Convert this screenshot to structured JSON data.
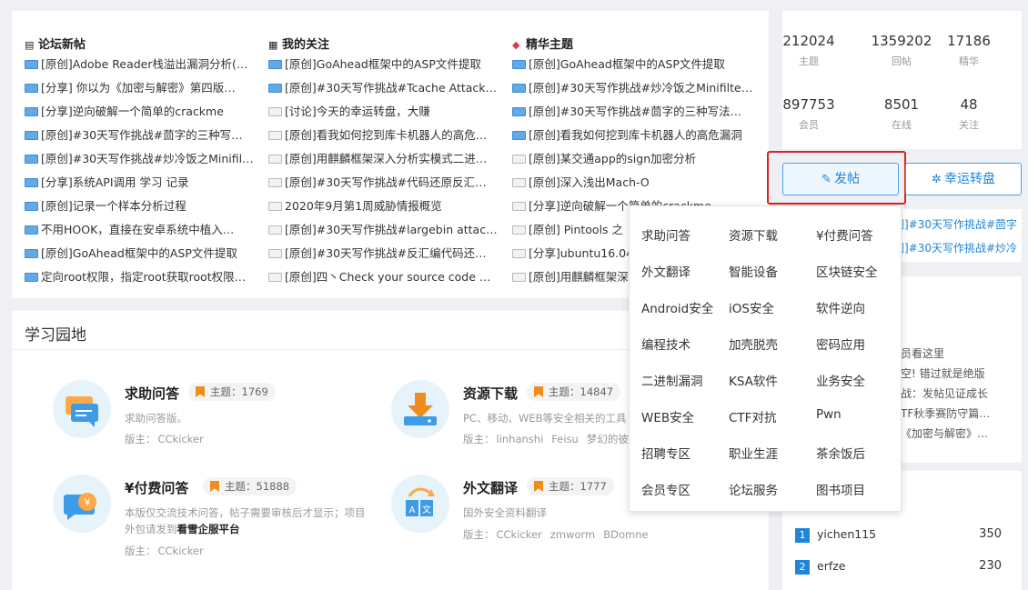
{
  "new_posts": {
    "title": "论坛新帖",
    "items": [
      "[原创]Adobe Reader栈溢出漏洞分析(…",
      "[分享] 你以为《加密与解密》第四版…",
      "[分享]逆向破解一个简单的crackme",
      "[原创]#30天写作挑战#茴字的三种写…",
      "[原创]#30天写作挑战#炒冷饭之Minifil…",
      "[分享]系统API调用 学习 记录",
      "[原创]记录一个样本分析过程",
      "不用HOOK，直接在安卓系统中植入…",
      "[原创]GoAhead框架中的ASP文件提取",
      "定向root权限，指定root获取root权限…"
    ]
  },
  "following": {
    "title": "我的关注",
    "items": [
      "[原创]GoAhead框架中的ASP文件提取",
      "[原创]#30天写作挑战#Tcache Attack…",
      "[讨论]今天的幸运转盘，大赚",
      "[原创]看我如何挖到库卡机器人的高危…",
      "[原创]用麒麟框架深入分析实模式二进…",
      "[原创]#30天写作挑战#代码还原反汇…",
      "2020年9月第1周威胁情报概览",
      "[原创]#30天写作挑战#largebin attack…",
      "[原创]#30天写作挑战#反汇编代码还…",
      "[原创]四丶Check your source code w…"
    ]
  },
  "featured": {
    "title": "精华主题",
    "items": [
      "[原创]GoAhead框架中的ASP文件提取",
      "[原创]#30天写作挑战#炒冷饭之Minifilter…",
      "[原创]#30天写作挑战#茴字的三种写法…",
      "[原创]看我如何挖到库卡机器人的高危漏洞",
      "[原创]某交通app的sign加密分析",
      "[原创]深入浅出Mach-O",
      "[分享]逆向破解一个简单的crackme",
      "[原创] Pintools 之",
      "[分享]ubuntu16.04",
      "[原创]用麒麟框架深"
    ]
  },
  "stats": [
    {
      "value": "212024",
      "label": "主题"
    },
    {
      "value": "1359202",
      "label": "回帖"
    },
    {
      "value": "17186",
      "label": "精华"
    },
    {
      "value": "897753",
      "label": "会员"
    },
    {
      "value": "8501",
      "label": "在线"
    },
    {
      "value": "48",
      "label": "关注"
    }
  ],
  "actions": {
    "post_label": "发帖",
    "lucky_label": "幸运转盘"
  },
  "side_links": [
    "创]#30天写作挑战#茴字",
    "创]#30天写作挑战#炒冷"
  ],
  "side_notice": [
    "员看这里",
    "空! 错过就是绝版",
    "战：发帖见证成长",
    "TF秋季赛防守篇…",
    "《加密与解密》…"
  ],
  "dropdown": {
    "items": [
      "求助问答",
      "资源下载",
      "¥付费问答",
      "外文翻译",
      "智能设备",
      "区块链安全",
      "Android安全",
      "iOS安全",
      "软件逆向",
      "编程技术",
      "加壳脱壳",
      "密码应用",
      "二进制漏洞",
      "KSA软件",
      "业务安全",
      "WEB安全",
      "CTF对抗",
      "Pwn",
      "招聘专区",
      "职业生涯",
      "茶余饭后",
      "会员专区",
      "论坛服务",
      "图书项目"
    ]
  },
  "learning": {
    "title": "学习园地",
    "forums": [
      {
        "title": "求助问答",
        "topics": "主题：1769",
        "desc": "求助问答版。",
        "mod_label": "版主：",
        "mods": [
          "CCkicker"
        ]
      },
      {
        "title": "资源下载",
        "topics": "主题：14847",
        "desc": "PC、移动、WEB等安全相关的工具",
        "mod_label": "版主：",
        "mods": [
          "linhanshi",
          "Feisu",
          "梦幻的彼"
        ]
      },
      {
        "title": "¥付费问答",
        "topics": "主题：51888",
        "desc": "本版仅交流技术问答，帖子需要审核后才显示；项目",
        "desc2": "外包请发到",
        "desc2_bold": "看雪企服平台",
        "mod_label": "版主：",
        "mods": [
          "CCkicker"
        ]
      },
      {
        "title": "外文翻译",
        "topics": "主题：1777",
        "desc": "国外安全资料翻译",
        "mod_label": "版主：",
        "mods": [
          "CCkicker",
          "zmworm",
          "BDomne"
        ]
      }
    ]
  },
  "ranking": [
    {
      "rank": "1",
      "name": "yichen115",
      "score": "350"
    },
    {
      "rank": "2",
      "name": "erfze",
      "score": "230"
    }
  ]
}
